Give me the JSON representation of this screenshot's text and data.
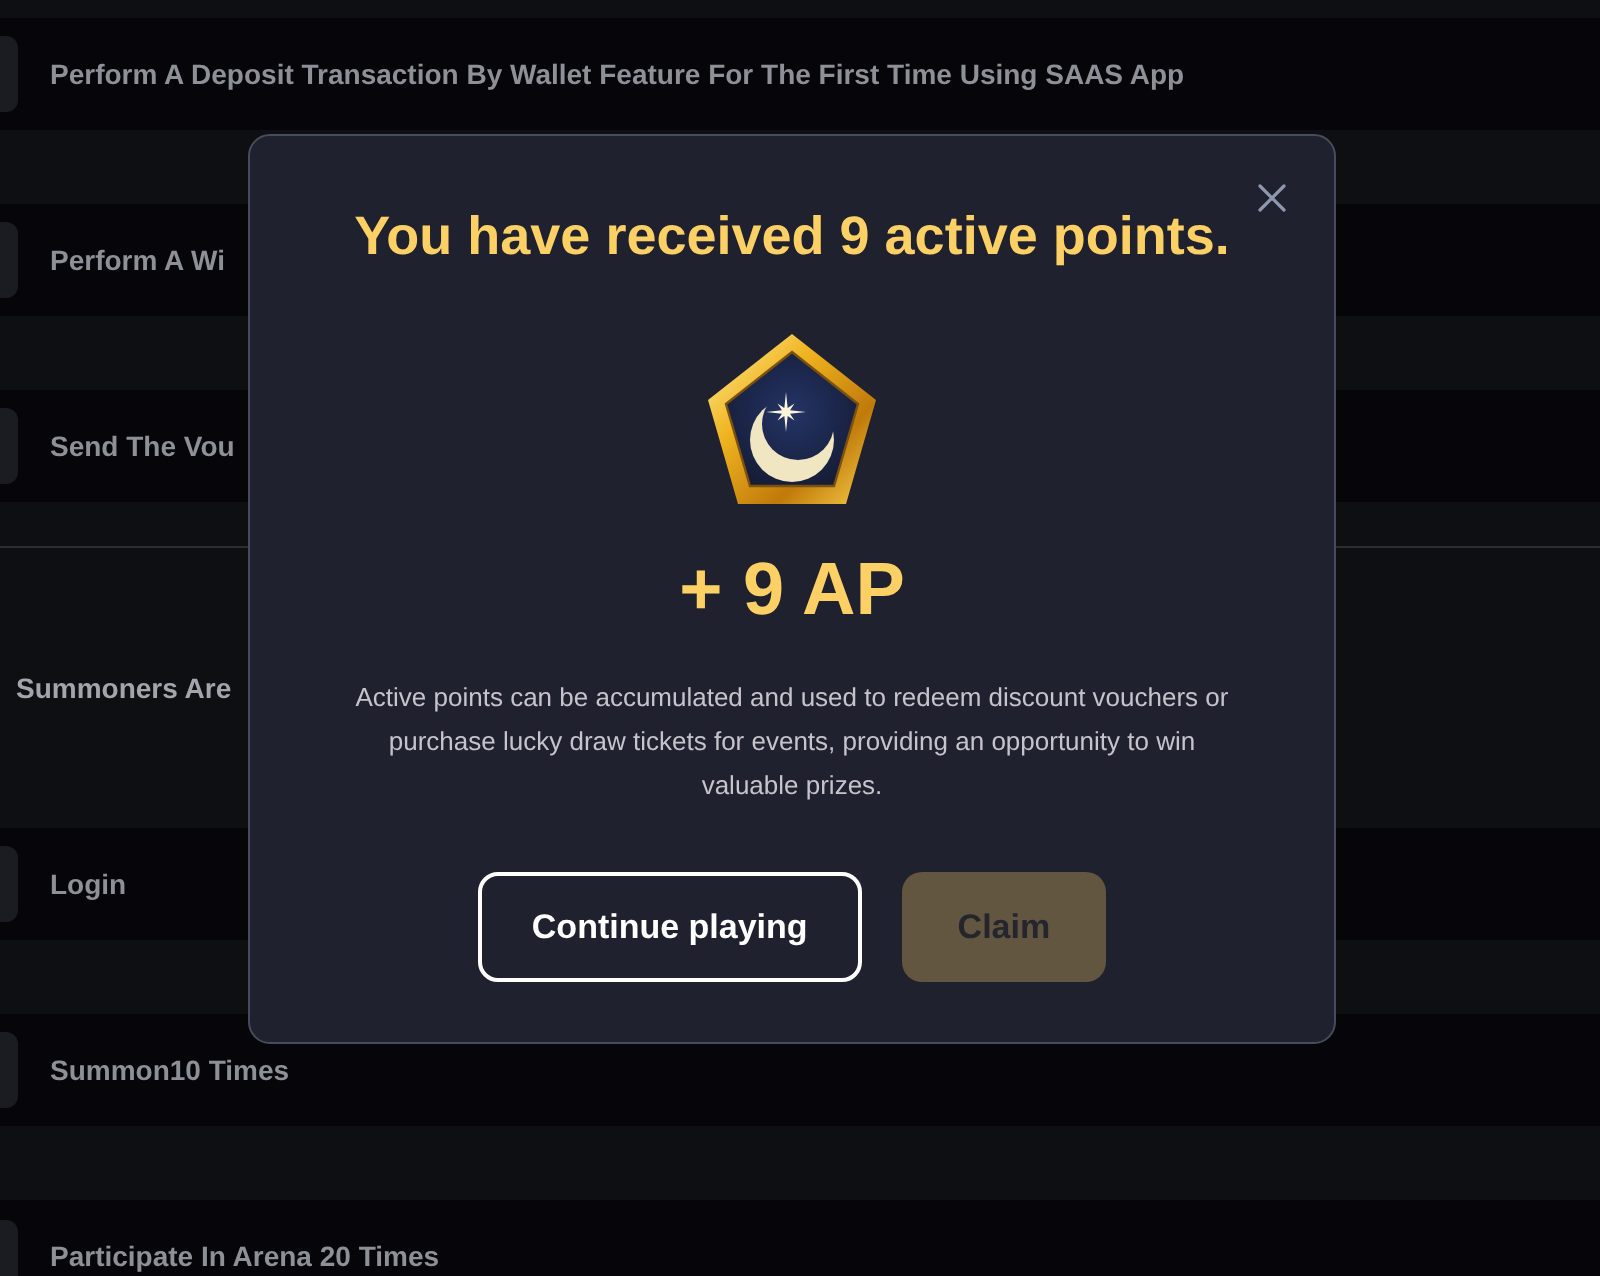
{
  "task_list": {
    "items": [
      {
        "kind": "task",
        "title": "Perform A Deposit Transaction By Wallet Feature For The First Time Using SAAS App"
      },
      {
        "kind": "task",
        "title": "Perform A Wi"
      },
      {
        "kind": "task",
        "title": "Send The Vou"
      },
      {
        "kind": "section",
        "title": "Summoners Are"
      },
      {
        "kind": "task",
        "title": "Login"
      },
      {
        "kind": "task",
        "title": "Summon10 Times"
      },
      {
        "kind": "task",
        "title": "Participate In Arena 20 Times"
      }
    ]
  },
  "dialog": {
    "title": "You have received 9 active points.",
    "reward": "+ 9 AP",
    "description": "Active points can be accumulated and used to redeem discount vouchers or purchase lucky draw tickets for events, providing an opportunity to win valuable prizes.",
    "buttons": [
      {
        "kind": "outline",
        "label": "Continue playing",
        "disabled": false
      },
      {
        "kind": "primary",
        "label": "Claim",
        "disabled": true
      }
    ]
  }
}
